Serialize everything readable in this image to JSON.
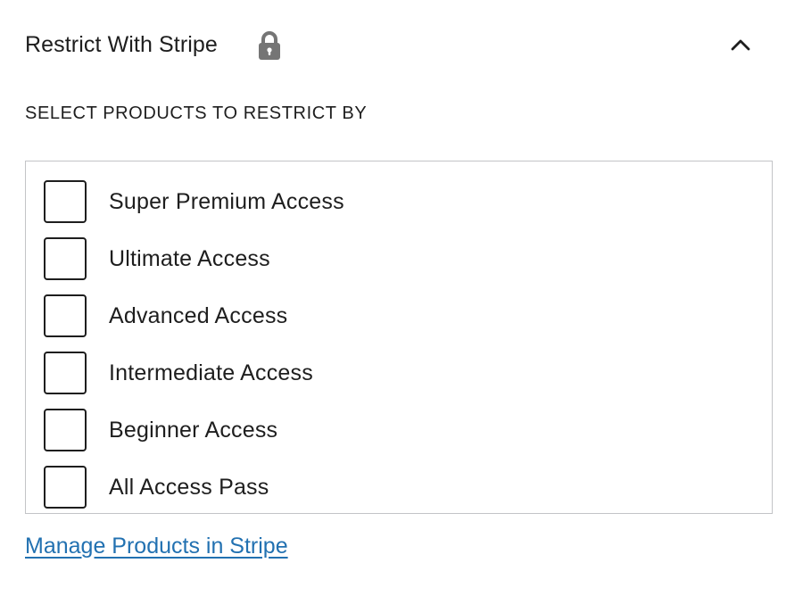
{
  "panel": {
    "title": "Restrict With Stripe",
    "lock_icon": "lock-icon",
    "toggle_icon": "chevron-up-icon"
  },
  "section_label": "SELECT PRODUCTS TO RESTRICT BY",
  "products": [
    {
      "label": "Super Premium Access",
      "checked": false
    },
    {
      "label": "Ultimate Access",
      "checked": false
    },
    {
      "label": "Advanced Access",
      "checked": false
    },
    {
      "label": "Intermediate Access",
      "checked": false
    },
    {
      "label": "Beginner Access",
      "checked": false
    },
    {
      "label": "All Access Pass",
      "checked": false
    }
  ],
  "manage_link": "Manage Products in Stripe",
  "colors": {
    "text": "#1e1e1e",
    "link": "#2271b1",
    "border": "#c3c4c7",
    "icon": "#757575"
  }
}
